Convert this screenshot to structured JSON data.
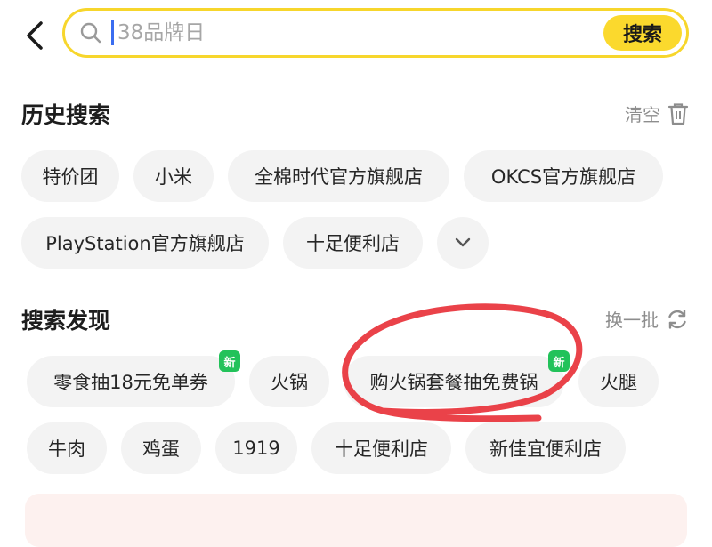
{
  "header": {
    "search_placeholder": "38品牌日",
    "search_button": "搜索"
  },
  "history": {
    "title": "历史搜索",
    "clear_label": "清空",
    "items": [
      "特价团",
      "小米",
      "全棉时代官方旗舰店",
      "OKCS官方旗舰店",
      "PlayStation官方旗舰店",
      "十足便利店"
    ]
  },
  "discover": {
    "title": "搜索发现",
    "refresh_label": "换一批",
    "new_badge": "新",
    "items": [
      "零食抽18元免单券",
      "火锅",
      "购火锅套餐抽免费锅",
      "火腿",
      "牛肉",
      "鸡蛋",
      "1919",
      "十足便利店",
      "新佳宜便利店"
    ]
  },
  "colors": {
    "accent": "#fbd92d",
    "badge": "#22c25a",
    "annotation": "#e8323a"
  }
}
